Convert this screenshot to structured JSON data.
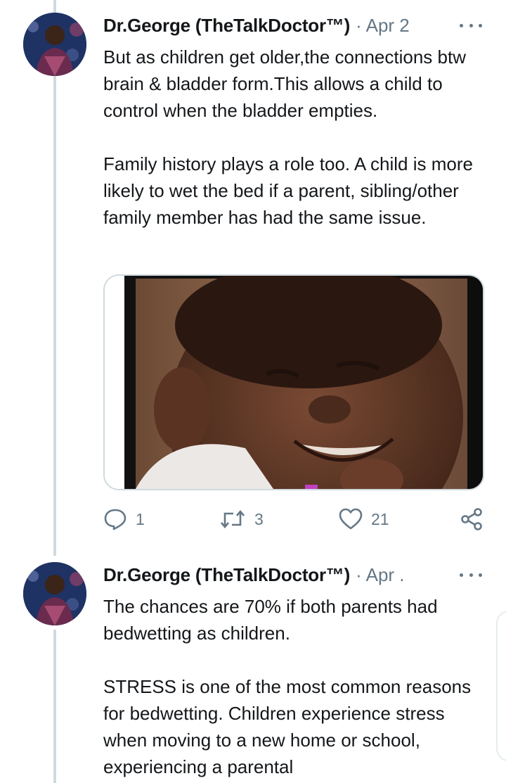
{
  "tweets": [
    {
      "author": "Dr.George (TheTalkDoctor™)",
      "date": "· Apr 2",
      "text": "But as children get older,the connections btw brain & bladder form.This allows a child to control when the bladder empties.\n\nFamily history plays a role too. A child is more likely to wet the bed if a parent, sibling/other family member has had the same issue.",
      "media": "gif-boy-smiling",
      "actions": {
        "replies": "1",
        "retweets": "3",
        "likes": "21"
      }
    },
    {
      "author": "Dr.George (TheTalkDoctor™)",
      "date": "· Apr .",
      "text": "The chances are 70% if both parents had bedwetting as children.\n\nSTRESS is one of the most common reasons for bedwetting. Children experience stress when moving to a new home or school, experiencing a parental"
    }
  ],
  "icons": {
    "reply": "speech-bubble-icon",
    "retweet": "retweet-arrows-icon",
    "like": "heart-outline-icon",
    "share": "share-nodes-icon",
    "more": "more-dots-icon"
  },
  "colors": {
    "thread_line": "#cfd9de",
    "secondary_text": "#657786",
    "primary_text": "#14171a"
  }
}
